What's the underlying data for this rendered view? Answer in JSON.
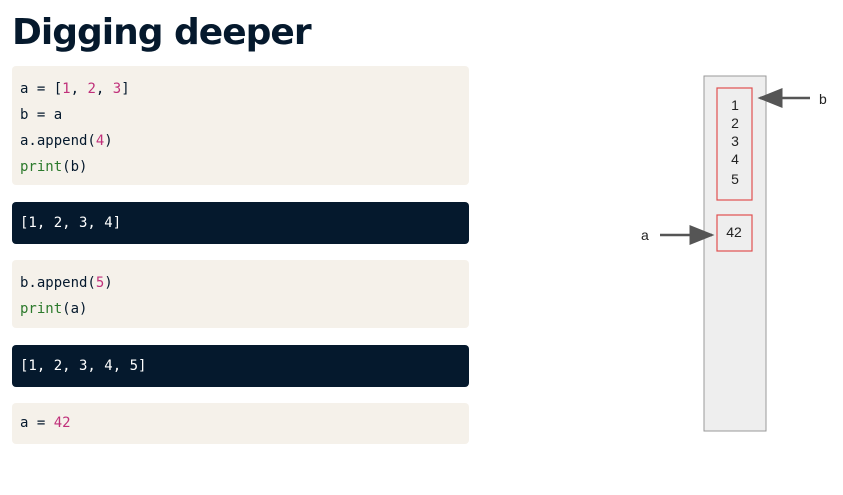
{
  "title": "Digging deeper",
  "code1": {
    "line1": {
      "a": "a = [",
      "n1": "1",
      "s1": ", ",
      "n2": "2",
      "s2": ", ",
      "n3": "3",
      "c": "]"
    },
    "line2": "b = a",
    "line3": {
      "pre": "a.append(",
      "num": "4",
      "post": ")"
    },
    "line4": {
      "fn": "print",
      "rest": "(b)"
    }
  },
  "output1": "[1, 2, 3, 4]",
  "code2": {
    "line1": {
      "pre": "b.append(",
      "num": "5",
      "post": ")"
    },
    "line2": {
      "fn": "print",
      "rest": "(a)"
    }
  },
  "output2": "[1, 2, 3, 4, 5]",
  "code3": {
    "pre": "a = ",
    "num": "42"
  },
  "diagram": {
    "list_values": [
      "1",
      "2",
      "3",
      "4",
      "5"
    ],
    "int_value": "42",
    "label_a": "a",
    "label_b": "b"
  }
}
